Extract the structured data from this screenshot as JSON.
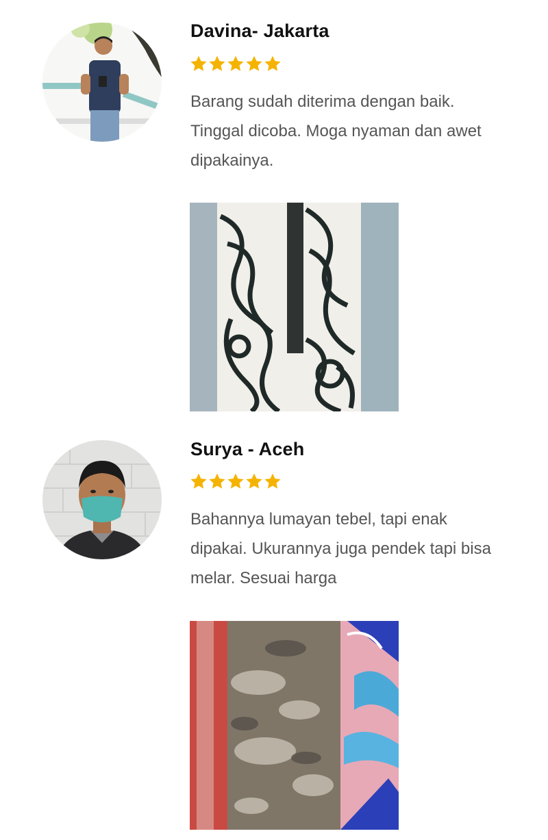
{
  "reviews": [
    {
      "name": "Davina- Jakarta",
      "rating": 5,
      "comment": "Barang sudah diterima dengan baik. Tinggal dicoba. Moga nyaman dan awet dipakainya.",
      "avatar_icon": "person-avatar-icon",
      "photo_icon": "product-photo-icon"
    },
    {
      "name": "Surya - Aceh",
      "rating": 5,
      "comment": "Bahannya lumayan tebel, tapi enak dipakai. Ukurannya juga pendek tapi bisa melar. Sesuai harga",
      "avatar_icon": "person-avatar-icon",
      "photo_icon": "product-photo-icon"
    }
  ],
  "colors": {
    "star": "#F5B301",
    "name_text": "#111111",
    "comment_text": "#555555"
  }
}
